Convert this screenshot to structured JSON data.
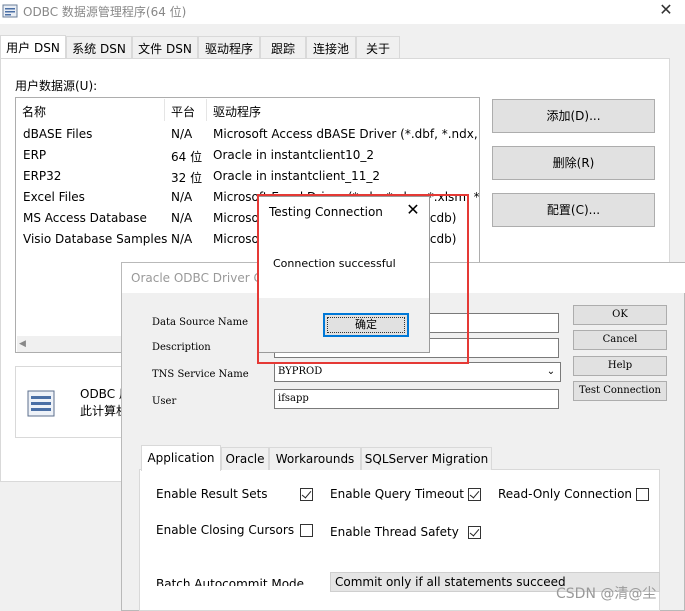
{
  "main_window": {
    "title": "ODBC 数据源管理程序(64 位)",
    "tabs": [
      {
        "label": "用户 DSN",
        "active": true
      },
      {
        "label": "系统 DSN",
        "active": false
      },
      {
        "label": "文件 DSN",
        "active": false
      },
      {
        "label": "驱动程序",
        "active": false
      },
      {
        "label": "跟踪",
        "active": false
      },
      {
        "label": "连接池",
        "active": false
      },
      {
        "label": "关于",
        "active": false
      }
    ],
    "list_label": "用户数据源(U):",
    "columns": [
      "名称",
      "平台",
      "驱动程序"
    ],
    "rows": [
      {
        "name": "dBASE Files",
        "platform": "N/A",
        "driver": "Microsoft Access dBASE Driver (*.dbf, *.ndx, *"
      },
      {
        "name": "ERP",
        "platform": "64 位",
        "driver": "Oracle in instantclient10_2"
      },
      {
        "name": "ERP32",
        "platform": "32 位",
        "driver": "Oracle in instantclient_11_2"
      },
      {
        "name": "Excel Files",
        "platform": "N/A",
        "driver": "Microsoft Excel Driver (*.xls, *.xlsx, *.xlsm, *.xlsb"
      },
      {
        "name": "MS Access Database",
        "platform": "N/A",
        "driver": "Microsoft Access Driver (*.mdb, *.accdb)"
      },
      {
        "name": "Visio Database Samples",
        "platform": "N/A",
        "driver": "Microsoft Access Driver (*.mdb, *.accdb)"
      }
    ],
    "buttons": {
      "add": "添加(D)...",
      "remove": "删除(R)",
      "configure": "配置(C)..."
    },
    "info": {
      "title": "ODBC 用",
      "text": "此计算机"
    }
  },
  "oracle_dialog": {
    "title": "Oracle ODBC Driver Configuration",
    "fields": {
      "data_source_name": {
        "label": "Data Source Name",
        "value": ""
      },
      "description": {
        "label": "Description",
        "value": ""
      },
      "tns_service_name": {
        "label": "TNS Service Name",
        "value": "BYPROD"
      },
      "user": {
        "label": "User",
        "value": "ifsapp"
      }
    },
    "buttons": {
      "ok": "OK",
      "cancel": "Cancel",
      "help": "Help",
      "test": "Test Connection"
    },
    "tabs": [
      {
        "label": "Application",
        "active": true
      },
      {
        "label": "Oracle",
        "active": false
      },
      {
        "label": "Workarounds",
        "active": false
      },
      {
        "label": "SQLServer Migration",
        "active": false
      }
    ],
    "options": {
      "enable_result_sets": {
        "label": "Enable Result Sets",
        "checked": true
      },
      "enable_query_timeout": {
        "label": "Enable Query Timeout",
        "checked": true
      },
      "read_only_connection": {
        "label": "Read-Only Connection",
        "checked": false
      },
      "enable_closing_cursors": {
        "label": "Enable Closing Cursors",
        "checked": false
      },
      "enable_thread_safety": {
        "label": "Enable Thread Safety",
        "checked": true
      }
    },
    "batch_autocommit": {
      "label": "Batch Autocommit Mode",
      "value": "Commit only if all statements succeed"
    }
  },
  "test_dialog": {
    "title": "Testing Connection",
    "message": "Connection successful",
    "ok_label": "确定"
  },
  "colors": {
    "highlight": "#e53935",
    "focus": "#0078d7"
  },
  "watermark": "CSDN @清@尘"
}
